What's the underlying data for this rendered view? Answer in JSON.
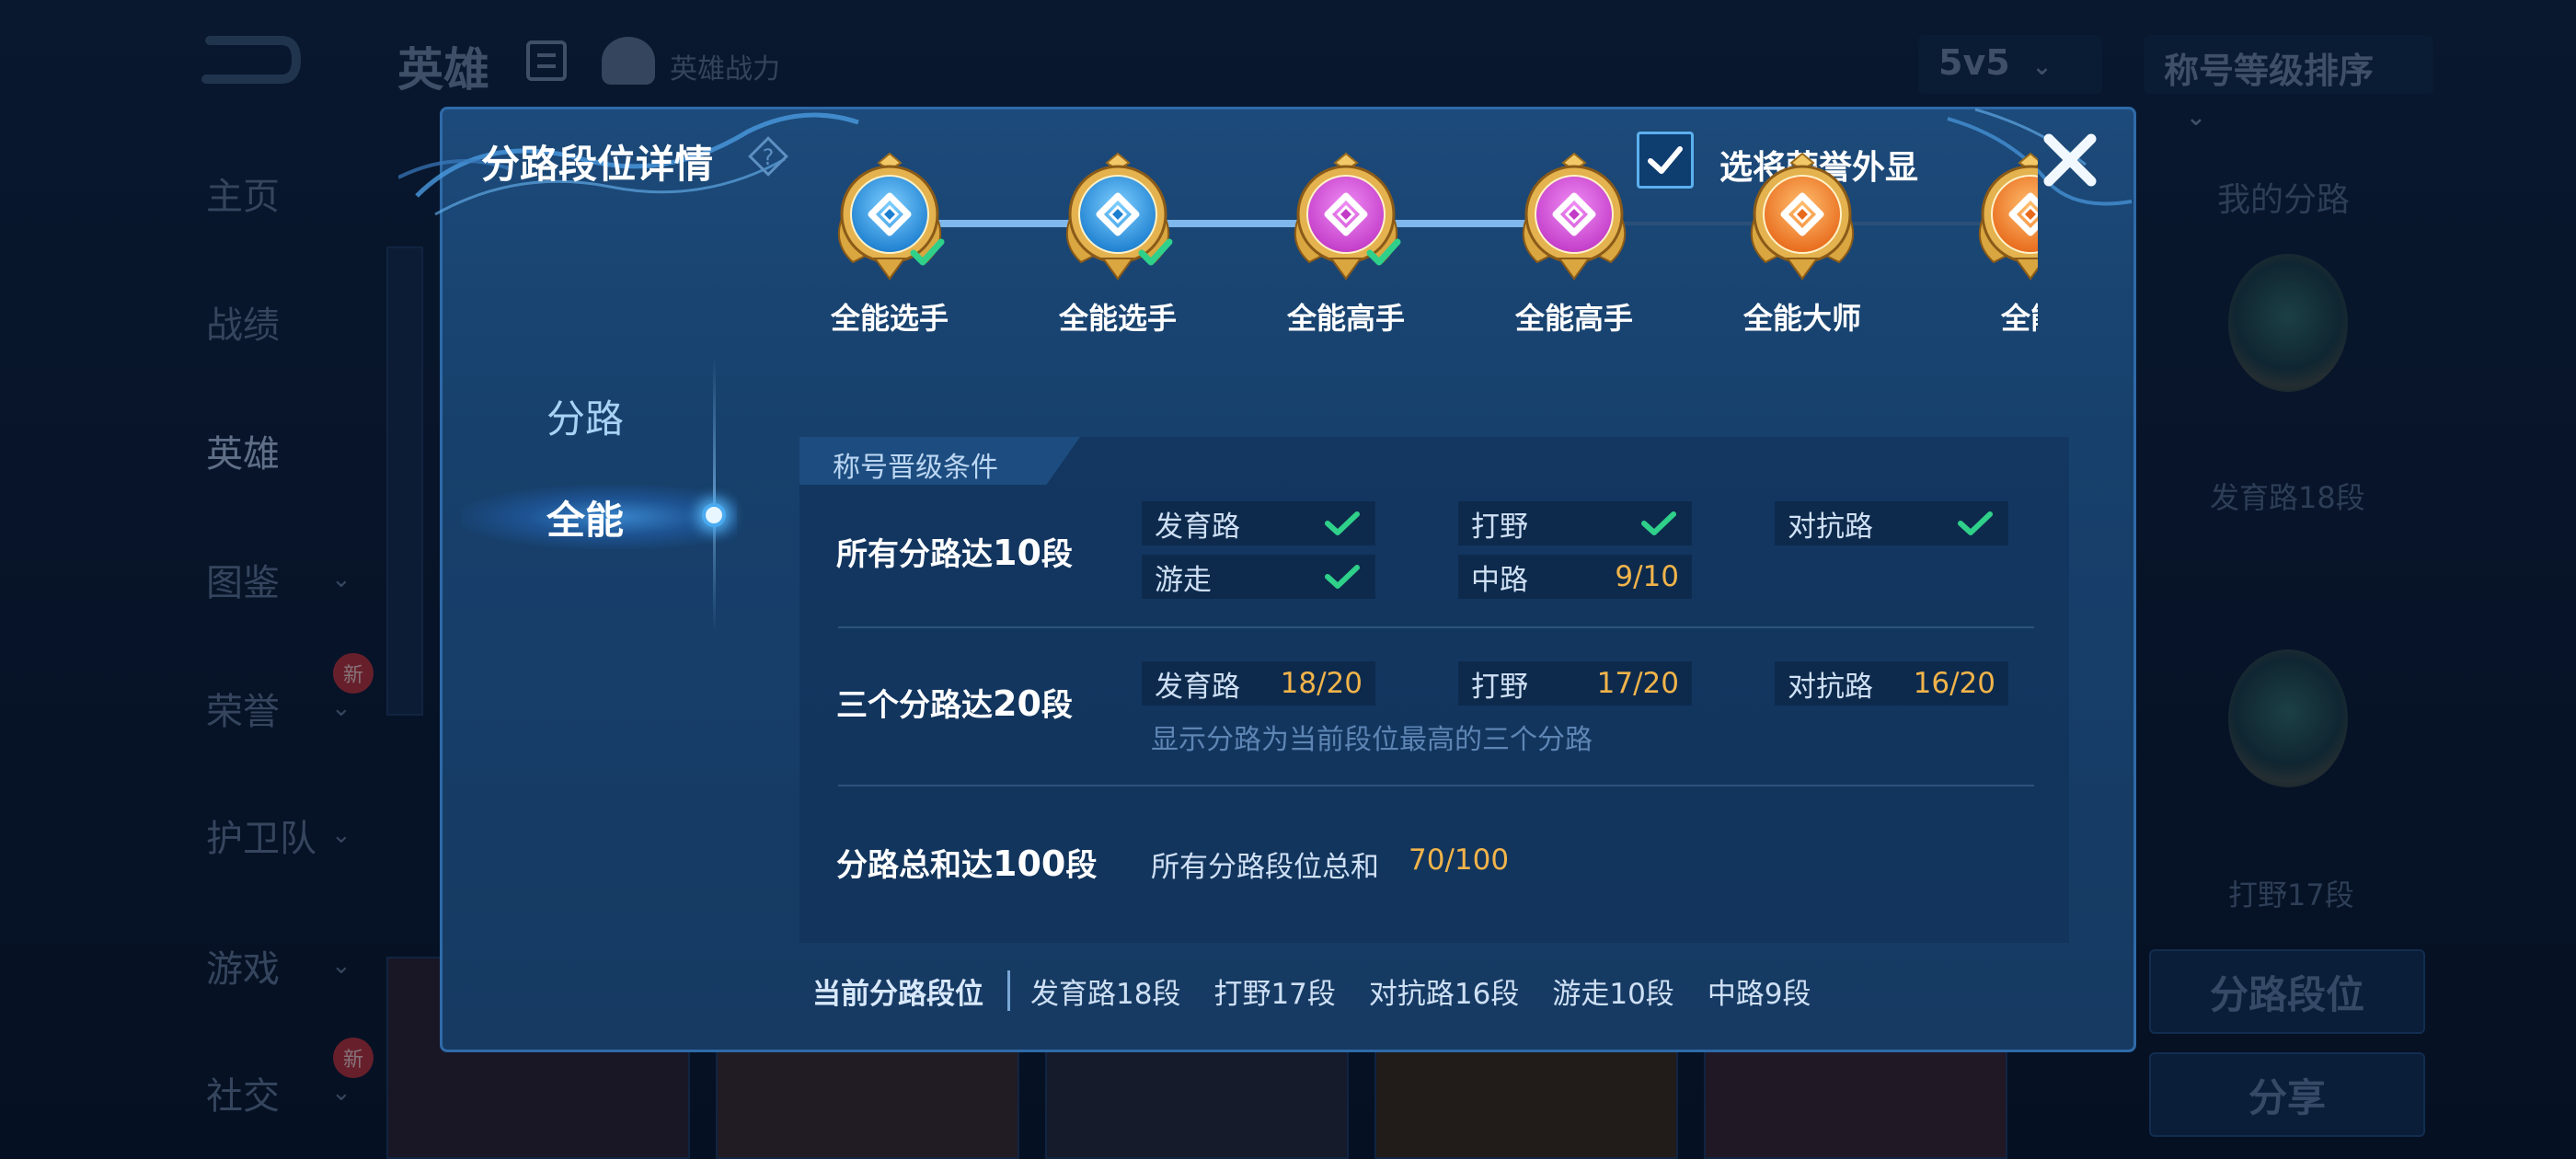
{
  "background": {
    "title": "英雄",
    "hero_power": "英雄战力",
    "mode_select": "5v5",
    "sort_select": "称号等级排序",
    "sidebar": [
      {
        "label": "主页"
      },
      {
        "label": "战绩"
      },
      {
        "label": "英雄"
      },
      {
        "label": "图鉴"
      },
      {
        "label": "荣誉",
        "badge": "新"
      },
      {
        "label": "护卫队"
      },
      {
        "label": "游戏"
      },
      {
        "label": "社交",
        "badge": "新"
      }
    ],
    "right_panel": {
      "title": "我的分路",
      "lane1": "发育路18段",
      "lane2": "打野17段",
      "btn_lane_rank": "分路段位",
      "btn_share": "分享"
    }
  },
  "modal": {
    "title": "分路段位详情",
    "honor_display_label": "选将荣誉外显",
    "honor_display_checked": true,
    "tabs": [
      {
        "label": "分路",
        "active": false
      },
      {
        "label": "全能",
        "active": true
      }
    ],
    "ranks": [
      {
        "name": "全能选手",
        "tier": "blue",
        "achieved": true
      },
      {
        "name": "全能选手",
        "tier": "blue",
        "achieved": true
      },
      {
        "name": "全能高手",
        "tier": "purple",
        "achieved": true
      },
      {
        "name": "全能高手",
        "tier": "purple",
        "achieved": false
      },
      {
        "name": "全能大师",
        "tier": "orange",
        "achieved": false
      },
      {
        "name": "全能",
        "tier": "orange",
        "achieved": false
      }
    ],
    "conditions_header": "称号晋级条件",
    "condition1": {
      "title_prefix": "所有分路达",
      "title_number": "10",
      "title_suffix": "段",
      "items": [
        {
          "label": "发育路",
          "done": true
        },
        {
          "label": "打野",
          "done": true
        },
        {
          "label": "对抗路",
          "done": true
        },
        {
          "label": "游走",
          "done": true
        },
        {
          "label": "中路",
          "progress": "9/10"
        }
      ]
    },
    "condition2": {
      "title_prefix": "三个分路达",
      "title_number": "20",
      "title_suffix": "段",
      "items": [
        {
          "label": "发育路",
          "progress": "18/20"
        },
        {
          "label": "打野",
          "progress": "17/20"
        },
        {
          "label": "对抗路",
          "progress": "16/20"
        }
      ],
      "note": "显示分路为当前段位最高的三个分路"
    },
    "condition3": {
      "title_prefix": "分路总和达",
      "title_number": "100",
      "title_suffix": "段",
      "sum_label": "所有分路段位总和",
      "progress": "70/100"
    },
    "current": {
      "title": "当前分路段位",
      "items": [
        "发育路18段",
        "打野17段",
        "对抗路16段",
        "游走10段",
        "中路9段"
      ]
    }
  },
  "colors": {
    "accent": "#5cb0ee",
    "progress_text": "#f2b44a",
    "check_green": "#2fd08a",
    "tier_blue": "#1d7fd0",
    "tier_purple": "#c23cc8",
    "tier_orange": "#e86a1c"
  }
}
